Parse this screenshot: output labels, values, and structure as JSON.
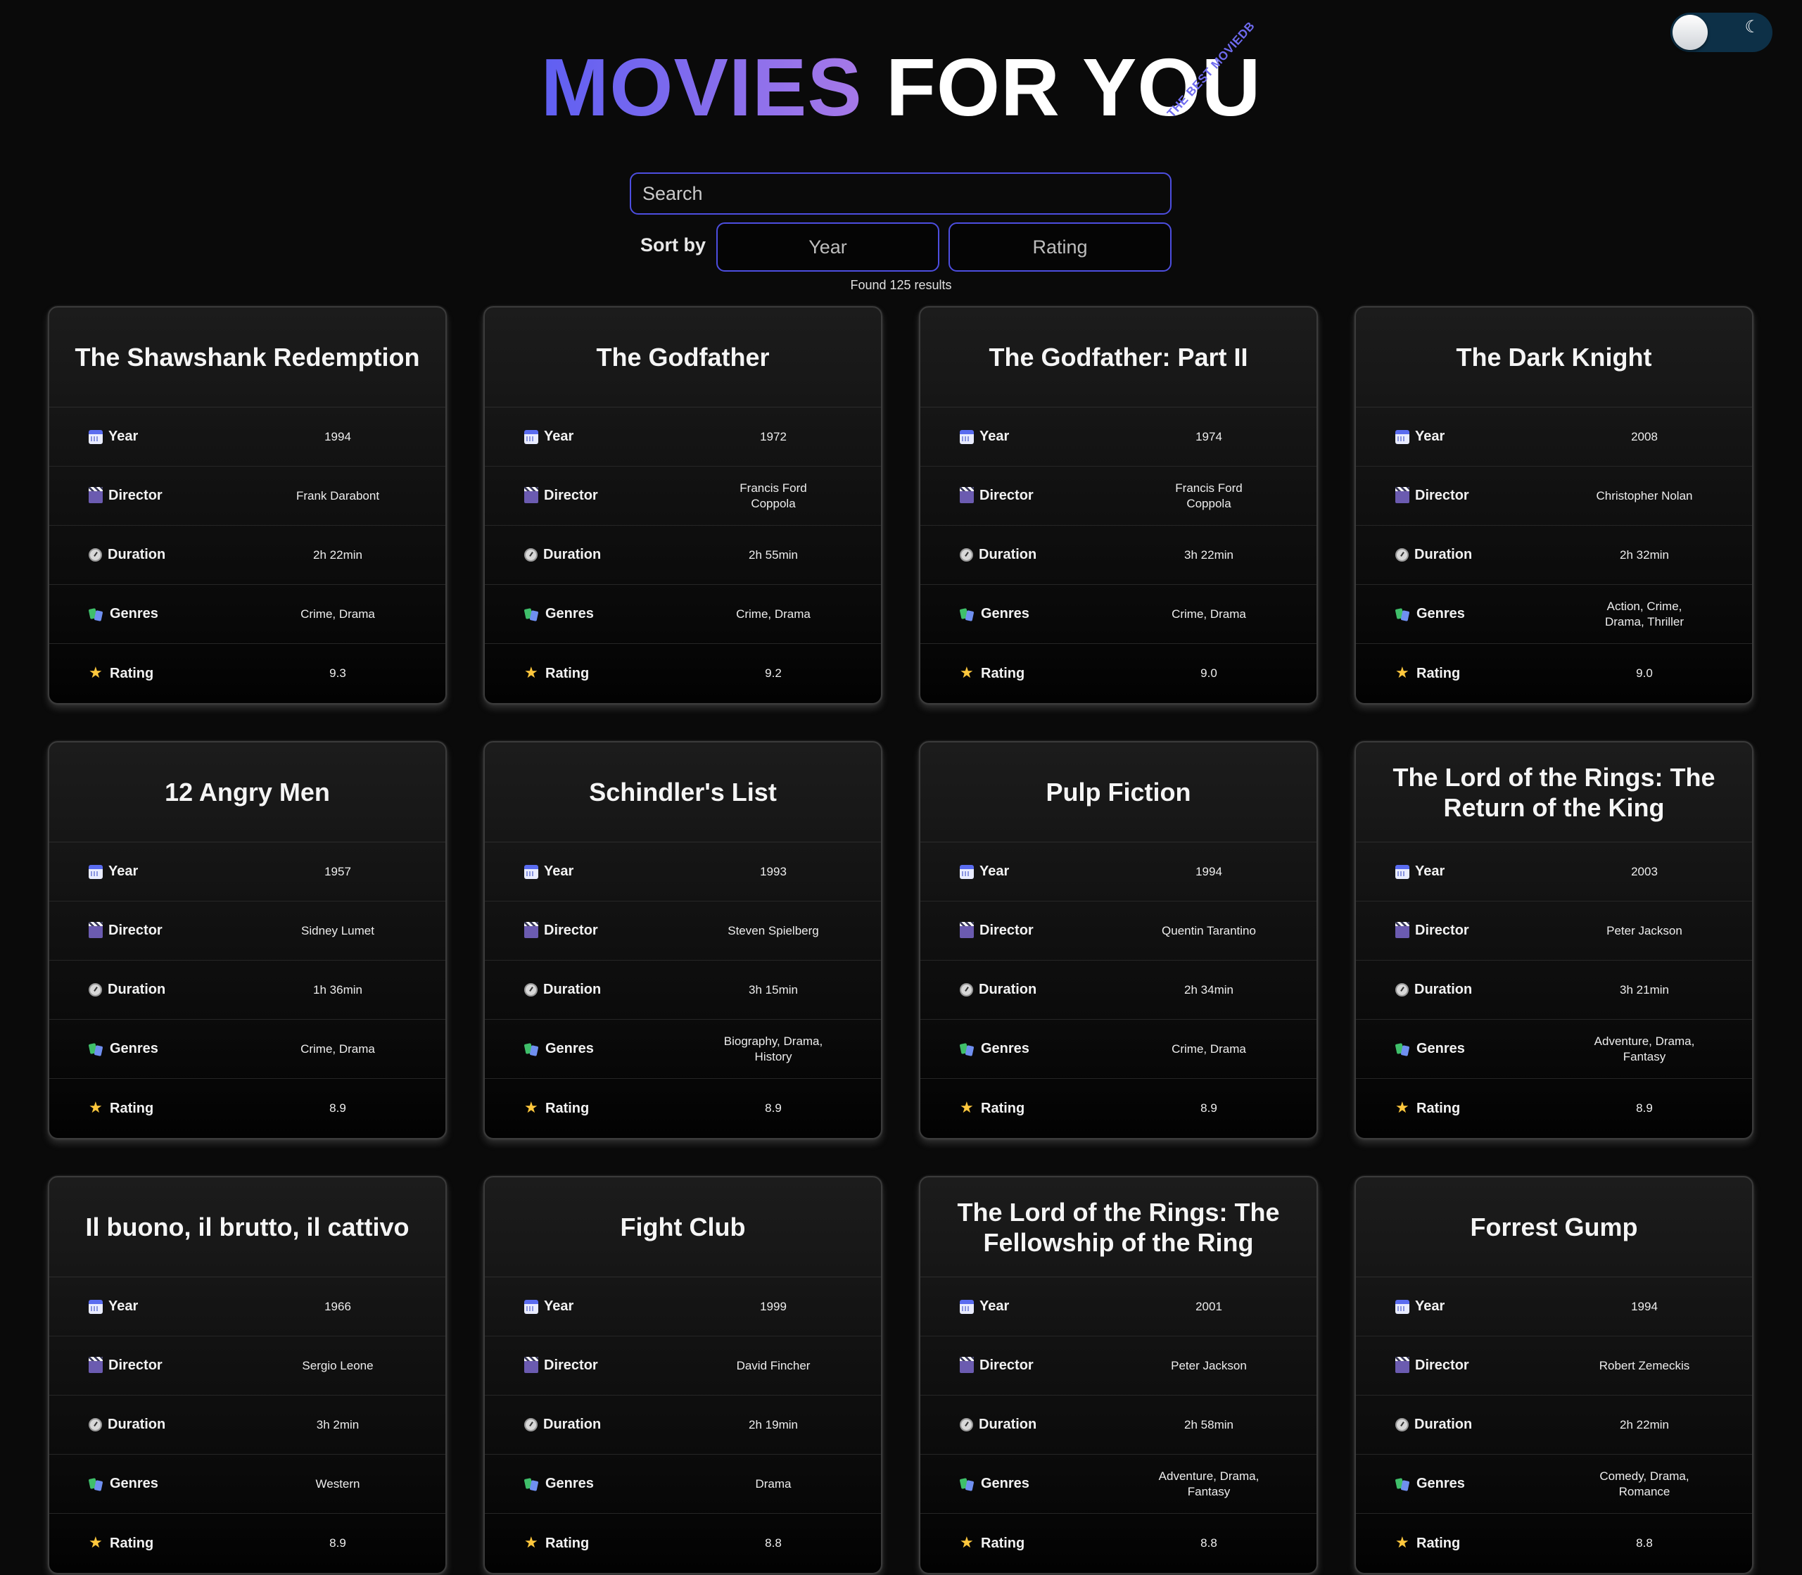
{
  "header": {
    "title_part1": "MOVIES",
    "title_part2": "FOR YOU",
    "tagline": "THE BEST MOVIEDB"
  },
  "search": {
    "placeholder": "Search",
    "value": ""
  },
  "sort": {
    "label": "Sort by",
    "year_label": "Year",
    "rating_label": "Rating"
  },
  "results_text": "Found 125 results",
  "field_labels": {
    "year": "Year",
    "director": "Director",
    "duration": "Duration",
    "genres": "Genres",
    "rating": "Rating"
  },
  "colors": {
    "accent": "#5f5ff2",
    "accent2": "#a679e8",
    "toggle": "#0d3047",
    "background": "#0a0a0a"
  },
  "movies": [
    {
      "title": "The Shawshank Redemption",
      "year": "1994",
      "director": "Frank Darabont",
      "duration": "2h 22min",
      "genres": "Crime, Drama",
      "rating": "9.3"
    },
    {
      "title": "The Godfather",
      "year": "1972",
      "director": "Francis Ford Coppola",
      "duration": "2h 55min",
      "genres": "Crime, Drama",
      "rating": "9.2"
    },
    {
      "title": "The Godfather: Part II",
      "year": "1974",
      "director": "Francis Ford Coppola",
      "duration": "3h 22min",
      "genres": "Crime, Drama",
      "rating": "9.0"
    },
    {
      "title": "The Dark Knight",
      "year": "2008",
      "director": "Christopher Nolan",
      "duration": "2h 32min",
      "genres": "Action, Crime, Drama, Thriller",
      "rating": "9.0"
    },
    {
      "title": "12 Angry Men",
      "year": "1957",
      "director": "Sidney Lumet",
      "duration": "1h 36min",
      "genres": "Crime, Drama",
      "rating": "8.9"
    },
    {
      "title": "Schindler's List",
      "year": "1993",
      "director": "Steven Spielberg",
      "duration": "3h 15min",
      "genres": "Biography, Drama, History",
      "rating": "8.9"
    },
    {
      "title": "Pulp Fiction",
      "year": "1994",
      "director": "Quentin Tarantino",
      "duration": "2h 34min",
      "genres": "Crime, Drama",
      "rating": "8.9"
    },
    {
      "title": "The Lord of the Rings: The Return of the King",
      "year": "2003",
      "director": "Peter Jackson",
      "duration": "3h 21min",
      "genres": "Adventure, Drama, Fantasy",
      "rating": "8.9"
    },
    {
      "title": "Il buono, il brutto, il cattivo",
      "year": "1966",
      "director": "Sergio Leone",
      "duration": "3h 2min",
      "genres": "Western",
      "rating": "8.9"
    },
    {
      "title": "Fight Club",
      "year": "1999",
      "director": "David Fincher",
      "duration": "2h 19min",
      "genres": "Drama",
      "rating": "8.8"
    },
    {
      "title": "The Lord of the Rings: The Fellowship of the Ring",
      "year": "2001",
      "director": "Peter Jackson",
      "duration": "2h 58min",
      "genres": "Adventure, Drama, Fantasy",
      "rating": "8.8"
    },
    {
      "title": "Forrest Gump",
      "year": "1994",
      "director": "Robert Zemeckis",
      "duration": "2h 22min",
      "genres": "Comedy, Drama, Romance",
      "rating": "8.8"
    }
  ]
}
